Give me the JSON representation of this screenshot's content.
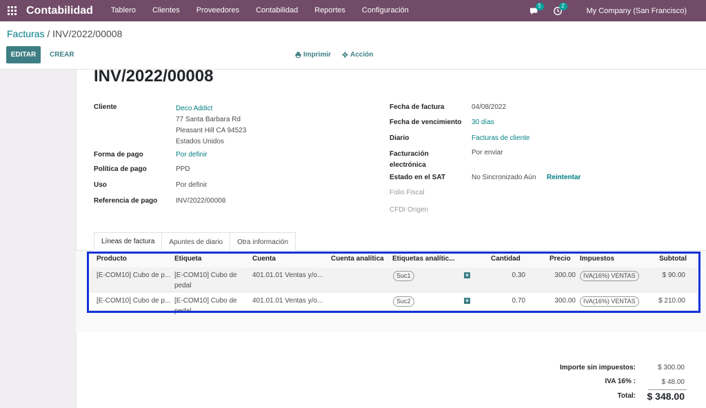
{
  "navbar": {
    "brand": "Contabilidad",
    "menu": [
      "Tablero",
      "Clientes",
      "Proveedores",
      "Contabilidad",
      "Reportes",
      "Configuración"
    ],
    "messages_count": "5",
    "activities_count": "2",
    "company": "My Company (San Francisco)",
    "color": "#714b67"
  },
  "breadcrumb": {
    "parent": "Facturas",
    "separator": " / ",
    "current": "INV/2022/00008"
  },
  "buttons": {
    "edit": "EDITAR",
    "create": "CREAR",
    "print": "Imprimir",
    "action": "Acción"
  },
  "invoice": {
    "title": "INV/2022/00008",
    "left": {
      "customer_label": "Cliente",
      "customer_name": "Deco Addict",
      "address_line1": "77 Santa Barbara Rd",
      "address_line2": "Pleasant Hill CA 94523",
      "address_line3": "Estados Unidos",
      "payment_form_label": "Forma de pago",
      "payment_form": "Por definir",
      "payment_policy_label": "Política de pago",
      "payment_policy": "PPD",
      "usage_label": "Uso",
      "usage": "Por definir",
      "payment_ref_label": "Referencia de pago",
      "payment_ref": "INV/2022/00008"
    },
    "right": {
      "invoice_date_label": "Fecha de factura",
      "invoice_date": "04/08/2022",
      "due_date_label": "Fecha de vencimiento",
      "due_date": "30 días",
      "journal_label": "Diario",
      "journal": "Facturas de cliente",
      "einvoice_label_1": "Facturación",
      "einvoice_label_2": "electrónica",
      "einvoice": "Por enviar",
      "sat_status_label": "Estado en el SAT",
      "sat_status": "No Sincronizado Aún",
      "retry": "Reintentar",
      "fiscal_folio_label": "Folio Fiscal",
      "cfdi_origin_label": "CFDI Origen"
    }
  },
  "tabs": [
    "Líneas de factura",
    "Apuntes de diario",
    "Otra información"
  ],
  "table": {
    "headers": {
      "product": "Producto",
      "label": "Etiqueta",
      "account": "Cuenta",
      "analytic_account": "Cuenta analítica",
      "analytic_tags": "Etiquetas analític...",
      "quantity": "Cantidad",
      "price": "Precio",
      "taxes": "Impuestos",
      "subtotal": "Subtotal"
    },
    "rows": [
      {
        "product": "[E-COM10] Cubo de p...",
        "label_1": "[E-COM10] Cubo de",
        "label_2": "pedal",
        "account": "401.01.01 Ventas y/o...",
        "tag": "Suc1",
        "quantity": "0.30",
        "price": "300.00",
        "tax": "IVA(16%) VENTAS",
        "subtotal": "$ 90.00"
      },
      {
        "product": "[E-COM10] Cubo de p...",
        "label_1": "[E-COM10] Cubo de",
        "label_2": "pedal",
        "account": "401.01.01 Ventas y/o...",
        "tag": "Suc2",
        "quantity": "0.70",
        "price": "300.00",
        "tax": "IVA(16%) VENTAS",
        "subtotal": "$ 210.00"
      }
    ]
  },
  "totals": {
    "untaxed_label": "Importe sin impuestos:",
    "untaxed": "$ 300.00",
    "iva_label": "IVA 16% :",
    "iva": "$ 48.00",
    "total_label": "Total:",
    "total": "$ 348.00"
  },
  "colors": {
    "accent": "#017e84",
    "button": "#3d7e84",
    "highlight": "#1232d8"
  }
}
